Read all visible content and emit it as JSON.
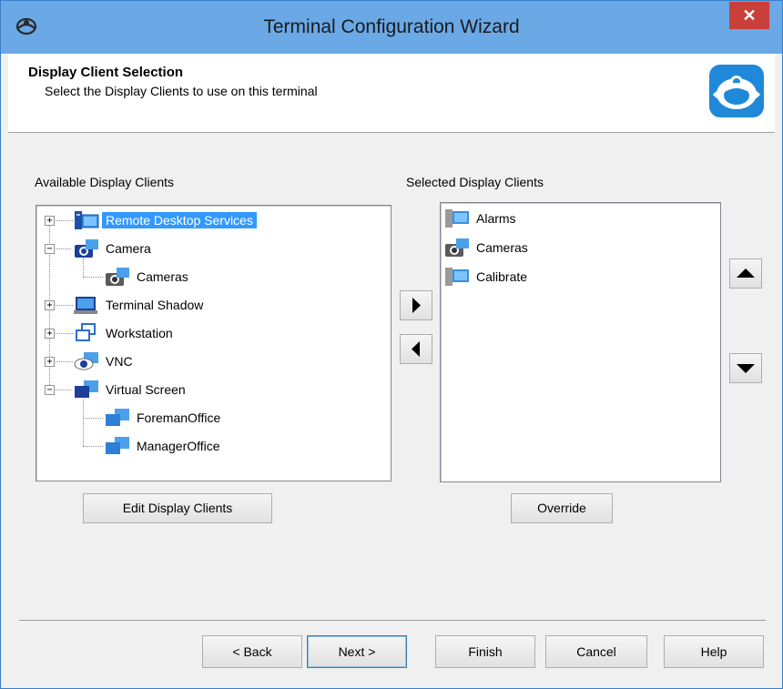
{
  "window": {
    "title": "Terminal Configuration Wizard",
    "close_glyph": "✕"
  },
  "header": {
    "title": "Display Client Selection",
    "subtitle": "Select the Display Clients to use on this terminal"
  },
  "available": {
    "label": "Available Display Clients",
    "items": [
      {
        "label": "Remote Desktop Services",
        "icon": "remote-desktop-icon",
        "expander": "+",
        "selected": true
      },
      {
        "label": "Camera",
        "icon": "camera-icon",
        "expander": "−"
      },
      {
        "label": "Cameras",
        "icon": "camera-icon"
      },
      {
        "label": "Terminal Shadow",
        "icon": "terminal-shadow-icon",
        "expander": "+"
      },
      {
        "label": "Workstation",
        "icon": "workstation-icon",
        "expander": "+"
      },
      {
        "label": "VNC",
        "icon": "vnc-icon",
        "expander": "+"
      },
      {
        "label": "Virtual Screen",
        "icon": "virtual-screen-icon",
        "expander": "−"
      },
      {
        "label": "ForemanOffice",
        "icon": "virtual-screen-icon"
      },
      {
        "label": "ManagerOffice",
        "icon": "virtual-screen-icon"
      }
    ],
    "edit_button": "Edit Display Clients"
  },
  "selected": {
    "label": "Selected Display Clients",
    "items": [
      {
        "label": "Alarms",
        "icon": "remote-desktop-icon"
      },
      {
        "label": "Cameras",
        "icon": "camera-icon"
      },
      {
        "label": "Calibrate",
        "icon": "remote-desktop-icon"
      }
    ],
    "override_button": "Override"
  },
  "footer": {
    "back": "< Back",
    "next": "Next >",
    "finish": "Finish",
    "cancel": "Cancel",
    "help": "Help"
  },
  "colors": {
    "titlebar": "#6aa8e6",
    "selection": "#3399ff",
    "close": "#c9403a"
  }
}
